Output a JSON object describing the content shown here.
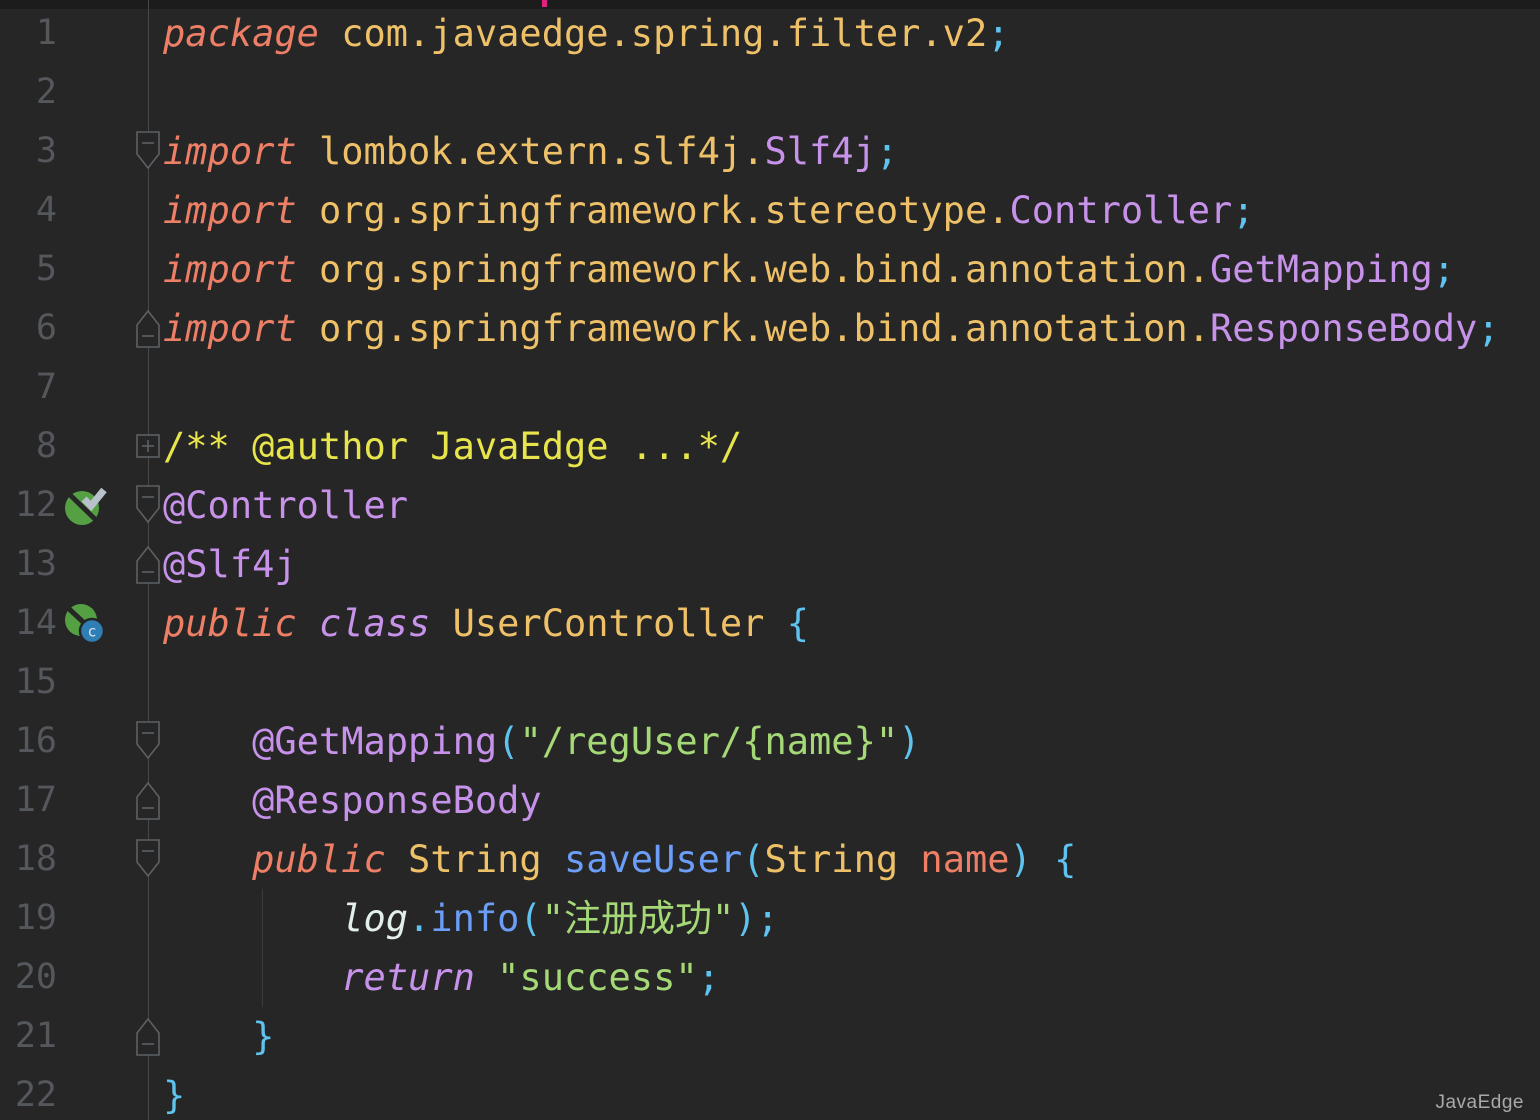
{
  "watermark": "JavaEdge",
  "editor": {
    "background": "#262626",
    "top_strip_color": "#1c1c1c",
    "pink_marker_color": "#e3217f",
    "fold_guide_color": "#474747",
    "fold_marker_stroke": "#5d6165",
    "colors": {
      "keyword": "#ec7f66",
      "identifier": "#eec168",
      "classname": "#c792ea",
      "punct": "#5fc3ef",
      "string": "#a5d977",
      "method": "#6c9ef8",
      "field": "#e3f0ea",
      "comment": "#e7e54b",
      "line_number": "#54575b"
    },
    "gutter_icons": {
      "spring-bean-check": {
        "circle": "#55a043",
        "slash": "#262626",
        "check": "#b9c2cb"
      },
      "spring-class": {
        "circle": "#55a043",
        "slash": "#262626",
        "badge": "#2f7fb5",
        "badge_ring": "#262626",
        "letter": "#d5e6f0"
      }
    },
    "lines": [
      {
        "num": "1",
        "tokens": [
          {
            "t": "package ",
            "c": "keyword",
            "i": true
          },
          {
            "t": "com.javaedge.spring.filter.v2",
            "c": "identifier"
          },
          {
            "t": ";",
            "c": "punct"
          }
        ]
      },
      {
        "num": "2",
        "tokens": []
      },
      {
        "num": "3",
        "fold": "start",
        "tokens": [
          {
            "t": "import ",
            "c": "keyword",
            "i": true
          },
          {
            "t": "lombok.extern.slf4j.",
            "c": "identifier"
          },
          {
            "t": "Slf4j",
            "c": "classname"
          },
          {
            "t": ";",
            "c": "punct"
          }
        ]
      },
      {
        "num": "4",
        "tokens": [
          {
            "t": "import ",
            "c": "keyword",
            "i": true
          },
          {
            "t": "org.springframework.stereotype.",
            "c": "identifier"
          },
          {
            "t": "Controller",
            "c": "classname"
          },
          {
            "t": ";",
            "c": "punct"
          }
        ]
      },
      {
        "num": "5",
        "tokens": [
          {
            "t": "import ",
            "c": "keyword",
            "i": true
          },
          {
            "t": "org.springframework.web.bind.annotation.",
            "c": "identifier"
          },
          {
            "t": "GetMapping",
            "c": "classname"
          },
          {
            "t": ";",
            "c": "punct"
          }
        ]
      },
      {
        "num": "6",
        "fold": "end",
        "tokens": [
          {
            "t": "import ",
            "c": "keyword",
            "i": true
          },
          {
            "t": "org.springframework.web.bind.annotation.",
            "c": "identifier"
          },
          {
            "t": "ResponseBody",
            "c": "classname"
          },
          {
            "t": ";",
            "c": "punct"
          }
        ]
      },
      {
        "num": "7",
        "tokens": []
      },
      {
        "num": "8",
        "fold": "plus",
        "tokens": [
          {
            "t": "/** @author JavaEdge ...*/",
            "c": "comment"
          }
        ]
      },
      {
        "num": "12",
        "fold": "start",
        "icon": "spring-bean-check",
        "tokens": [
          {
            "t": "@Controller",
            "c": "classname"
          }
        ]
      },
      {
        "num": "13",
        "fold": "end",
        "tokens": [
          {
            "t": "@Slf4j",
            "c": "classname"
          }
        ]
      },
      {
        "num": "14",
        "icon": "spring-class",
        "tokens": [
          {
            "t": "public ",
            "c": "keyword",
            "i": true
          },
          {
            "t": "class ",
            "c": "classname",
            "i": true
          },
          {
            "t": "UserController ",
            "c": "identifier"
          },
          {
            "t": "{",
            "c": "punct"
          }
        ]
      },
      {
        "num": "15",
        "tokens": []
      },
      {
        "num": "16",
        "fold": "start",
        "tokens": [
          {
            "t": "    ",
            "c": "punct"
          },
          {
            "t": "@GetMapping",
            "c": "classname"
          },
          {
            "t": "(",
            "c": "punct"
          },
          {
            "t": "\"/regUser/{name}\"",
            "c": "string"
          },
          {
            "t": ")",
            "c": "punct"
          }
        ]
      },
      {
        "num": "17",
        "fold": "end",
        "tokens": [
          {
            "t": "    ",
            "c": "punct"
          },
          {
            "t": "@ResponseBody",
            "c": "classname"
          }
        ]
      },
      {
        "num": "18",
        "fold": "start",
        "tokens": [
          {
            "t": "    ",
            "c": "punct"
          },
          {
            "t": "public ",
            "c": "keyword",
            "i": true
          },
          {
            "t": "String ",
            "c": "identifier"
          },
          {
            "t": "saveUser",
            "c": "method"
          },
          {
            "t": "(",
            "c": "punct"
          },
          {
            "t": "String ",
            "c": "identifier"
          },
          {
            "t": "name",
            "c": "keyword"
          },
          {
            "t": ") {",
            "c": "punct"
          }
        ]
      },
      {
        "num": "19",
        "tokens": [
          {
            "t": "        ",
            "c": "punct"
          },
          {
            "t": "log",
            "c": "field",
            "i": true
          },
          {
            "t": ".",
            "c": "punct"
          },
          {
            "t": "info",
            "c": "method"
          },
          {
            "t": "(",
            "c": "punct"
          },
          {
            "t": "\"注册成功\"",
            "c": "string"
          },
          {
            "t": ");",
            "c": "punct"
          }
        ]
      },
      {
        "num": "20",
        "tokens": [
          {
            "t": "        ",
            "c": "punct"
          },
          {
            "t": "return ",
            "c": "classname",
            "i": true
          },
          {
            "t": "\"success\"",
            "c": "string"
          },
          {
            "t": ";",
            "c": "punct"
          }
        ]
      },
      {
        "num": "21",
        "fold": "end",
        "tokens": [
          {
            "t": "    }",
            "c": "punct"
          }
        ]
      },
      {
        "num": "22",
        "tokens": [
          {
            "t": "}",
            "c": "punct"
          }
        ]
      }
    ]
  }
}
